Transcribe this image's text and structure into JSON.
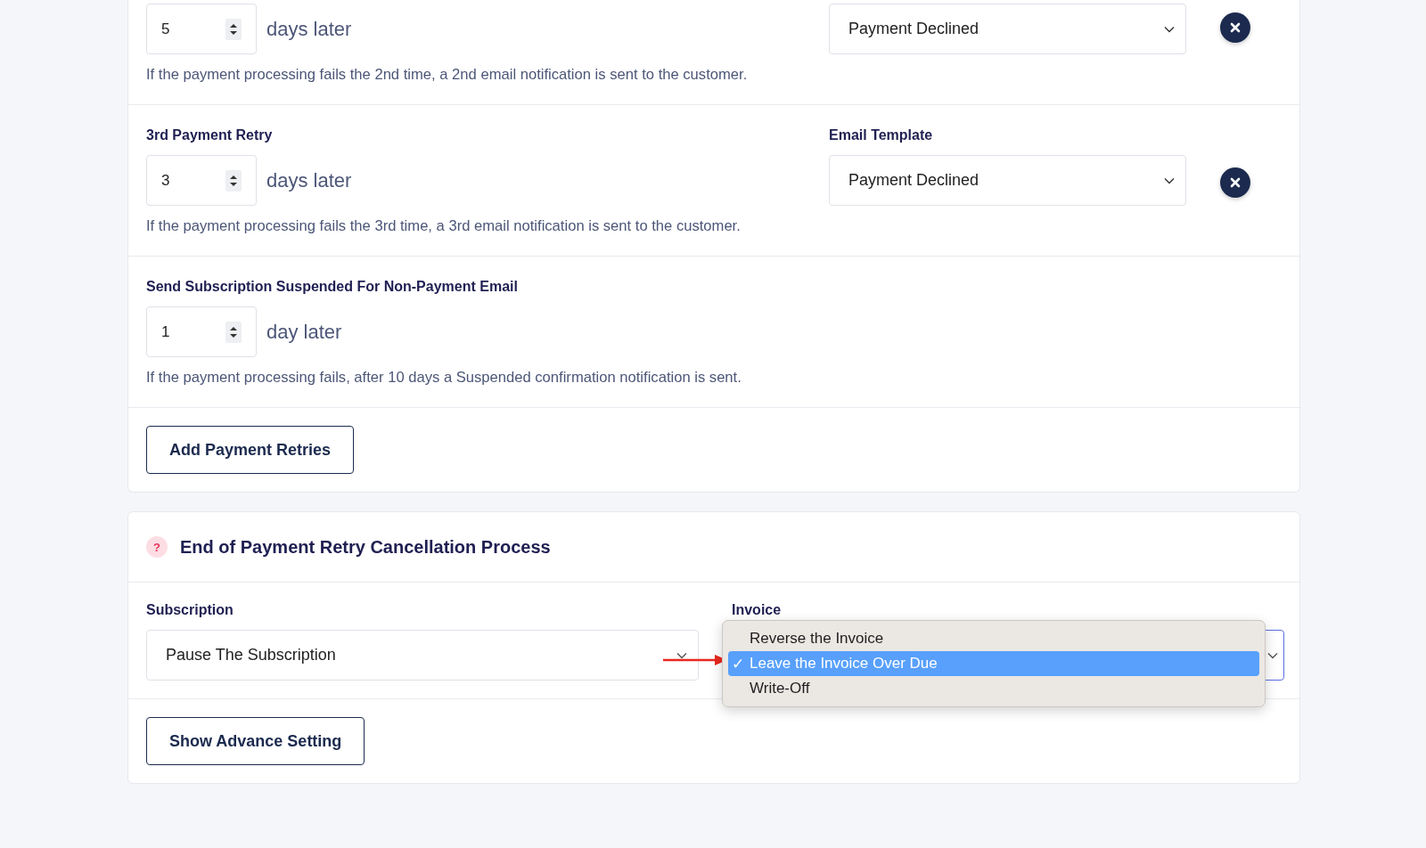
{
  "retries": [
    {
      "kind": "retry",
      "value": "5",
      "unit": "days later",
      "help": "If the payment processing fails the 2nd time, a 2nd email notification is sent to the customer.",
      "template": "Payment Declined"
    },
    {
      "kind": "retry",
      "label": "3rd Payment Retry",
      "value": "3",
      "unit": "days later",
      "help": "If the payment processing fails the 3rd time, a 3rd email notification is sent to the customer.",
      "template_label": "Email Template",
      "template": "Payment Declined"
    },
    {
      "kind": "suspend",
      "label": "Send Subscription Suspended For Non-Payment Email",
      "value": "1",
      "unit": "day later",
      "help": "If the payment processing fails, after 10 days a Suspended confirmation notification is sent."
    }
  ],
  "add_button": "Add Payment Retries",
  "cancellation": {
    "help_glyph": "?",
    "title": "End of Payment Retry Cancellation Process",
    "subscription": {
      "label": "Subscription",
      "value": "Pause The Subscription"
    },
    "invoice": {
      "label": "Invoice",
      "focused": true,
      "menu_open": true,
      "check_glyph": "✓",
      "options": [
        {
          "label": "Reverse the Invoice",
          "selected": false
        },
        {
          "label": "Leave the Invoice Over Due",
          "selected": true
        },
        {
          "label": "Write-Off",
          "selected": false
        }
      ]
    },
    "advanced_button": "Show Advance Setting"
  }
}
